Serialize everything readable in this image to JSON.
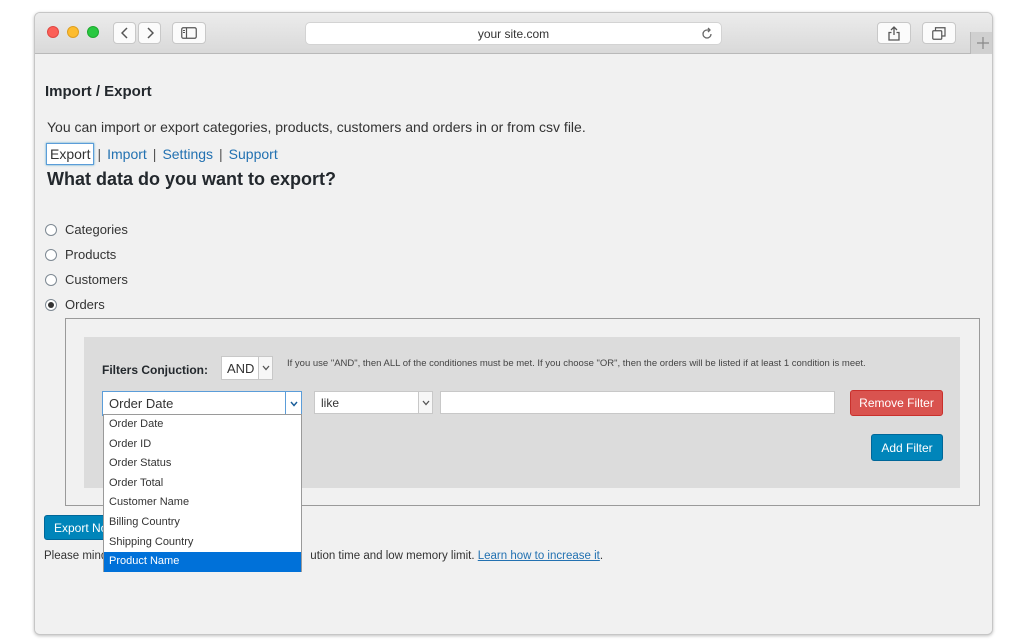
{
  "browser": {
    "url": "your site.com"
  },
  "page": {
    "title": "Import / Export",
    "description": "You can import or export categories, products, customers and orders in or from csv file.",
    "tabs": [
      {
        "label": "Export"
      },
      {
        "label": "Import"
      },
      {
        "label": "Settings"
      },
      {
        "label": "Support"
      }
    ],
    "tab_separator": "|",
    "section_heading": "What data do you want to export?",
    "data_types": [
      {
        "label": "Categories",
        "checked": false
      },
      {
        "label": "Products",
        "checked": false
      },
      {
        "label": "Customers",
        "checked": false
      },
      {
        "label": "Orders",
        "checked": true
      }
    ]
  },
  "filters": {
    "conjunction_label": "Filters Conjuction:",
    "conjunction_value": "AND",
    "conjunction_note": "If you use \"AND\", then ALL of the conditiones must be met. If you choose \"OR\", then the orders will be listed if at least 1 condition is meet.",
    "field_value": "Order Date",
    "operator_value": "like",
    "value_input": "",
    "remove_label": "Remove Filter",
    "add_label": "Add Filter",
    "field_options": [
      {
        "label": "Order Date",
        "selected": false
      },
      {
        "label": "Order ID",
        "selected": false
      },
      {
        "label": "Order Status",
        "selected": false
      },
      {
        "label": "Order Total",
        "selected": false
      },
      {
        "label": "Customer Name",
        "selected": false
      },
      {
        "label": "Billing Country",
        "selected": false
      },
      {
        "label": "Shipping Country",
        "selected": false
      },
      {
        "label": "Product Name",
        "selected": true
      }
    ]
  },
  "footer": {
    "export_label": "Export No",
    "note_prefix": "Please mind",
    "note_middle": "ution time and low memory limit.",
    "note_link": "Learn how to increase it",
    "note_suffix": "."
  }
}
